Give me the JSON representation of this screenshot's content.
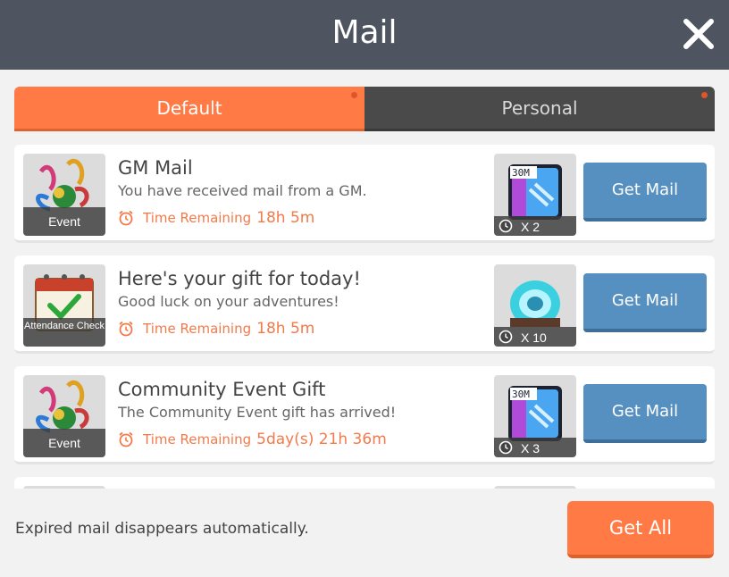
{
  "header": {
    "title": "Mail"
  },
  "tabs": [
    {
      "label": "Default",
      "active": true
    },
    {
      "label": "Personal",
      "active": false
    }
  ],
  "mails": [
    {
      "title": "GM Mail",
      "description": "You have received mail from a GM.",
      "time_label": "Time Remaining",
      "time_value": "18h 5m",
      "category": "Event",
      "category_icon": "event-confetti-icon",
      "reward_icon": "30m-booster-icon",
      "reward_qty": "X 2",
      "button_label": "Get Mail"
    },
    {
      "title": "Here's your gift for today!",
      "description": "Good luck on your adventures!",
      "time_label": "Time Remaining",
      "time_value": "18h 5m",
      "category": "Attendance Check",
      "category_icon": "calendar-check-icon",
      "reward_icon": "crystal-coin-icon",
      "reward_qty": "X 10",
      "button_label": "Get Mail"
    },
    {
      "title": "Community Event Gift",
      "description": "The Community Event gift has arrived!",
      "time_label": "Time Remaining",
      "time_value": "5day(s) 21h 36m",
      "category": "Event",
      "category_icon": "event-confetti-icon",
      "reward_icon": "30m-booster-icon",
      "reward_qty": "X 3",
      "button_label": "Get Mail"
    }
  ],
  "footer": {
    "note": "Expired mail disappears automatically.",
    "get_all_label": "Get All"
  },
  "colors": {
    "accent": "#ff7a45",
    "button_blue": "#5690c0",
    "header": "#4e5561"
  }
}
